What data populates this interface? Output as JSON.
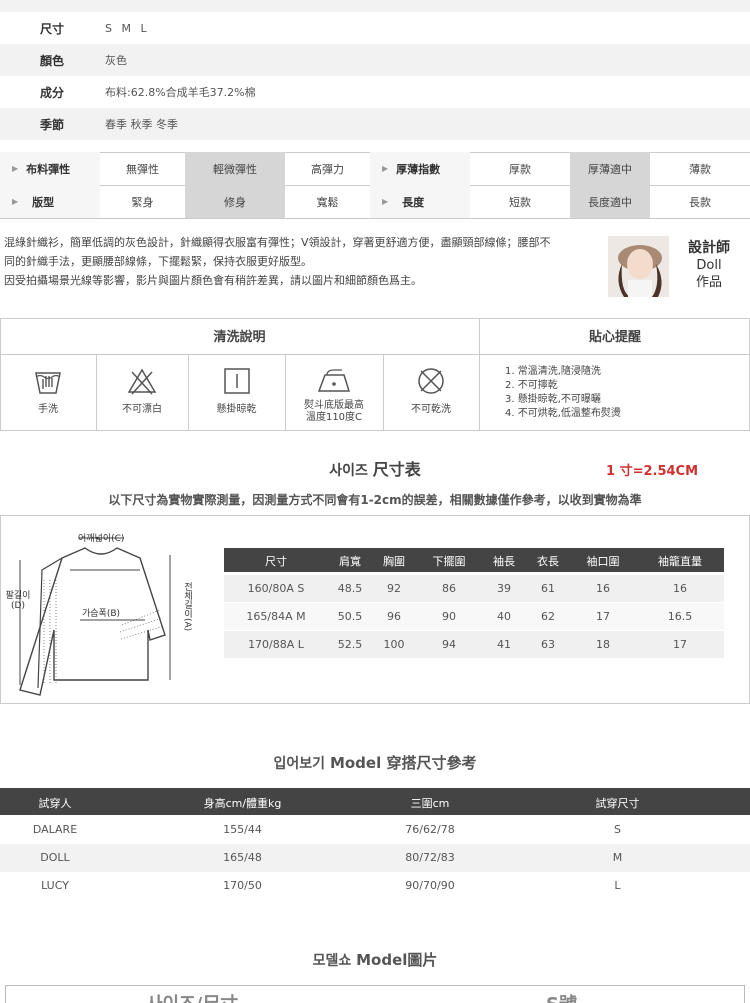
{
  "spec": [
    {
      "key": "尺寸",
      "value": "S M L"
    },
    {
      "key": "顏色",
      "value": "灰色"
    },
    {
      "key": "成分",
      "value": "布料:62.8%合成羊毛37.2%棉"
    },
    {
      "key": "季節",
      "value": "春季 秋季 冬季"
    }
  ],
  "attributes": {
    "row1": {
      "label1": "布料彈性",
      "opts1": [
        "無彈性",
        "輕微彈性",
        "高彈力"
      ],
      "label2": "厚薄指數",
      "opts2": [
        "厚款",
        "厚薄適中",
        "薄款"
      ]
    },
    "row2": {
      "label1": "版型",
      "opts1": [
        "緊身",
        "修身",
        "寬鬆"
      ],
      "label2": "長度",
      "opts2": [
        "短款",
        "長度適中",
        "長款"
      ]
    }
  },
  "description": {
    "line1": "混綠針織衫，簡單低調的灰色設計，針織顯得衣服富有彈性；V領設計，穿著更舒適方便，盡顯頸部線條；腰部不",
    "line2": "同的針織手法，更顯腰部線條，下擺鬆緊，保持衣服更好版型。",
    "line3": "因受拍攝場景光線等影響，影片與圖片顏色會有稍許差異，請以圖片和細節顏色爲主。"
  },
  "designer": {
    "title": "設計師",
    "name": "Doll",
    "suffix": "作品"
  },
  "care": {
    "title": "清洗說明",
    "tips_title": "貼心提醒",
    "items": [
      {
        "icon": "hand-wash-icon",
        "label": "手洗"
      },
      {
        "icon": "no-bleach-icon",
        "label": "不可漂白"
      },
      {
        "icon": "hang-dry-icon",
        "label": "懸掛晾乾"
      },
      {
        "icon": "iron-low-icon",
        "label": "熨斗底版最高",
        "label2": "溫度110度C"
      },
      {
        "icon": "no-dry-clean-icon",
        "label": "不可乾洗"
      }
    ],
    "tips": [
      "1. 常溫清洗,隨浸隨洗",
      "2. 不可擰乾",
      "3. 懸掛晾乾,不可曝曬",
      "4. 不可烘乾,低溫整布熨燙"
    ]
  },
  "size_section": {
    "title_kr": "사이즈",
    "title_zh": "尺寸表",
    "conversion": "1 寸=2.54CM",
    "note": "以下尺寸為實物實際測量，因測量方式不同會有1-2cm的誤差，相關數據僅作參考，以收到實物為準",
    "diagram_labels": {
      "shoulder": "어깨넓이(C)",
      "chest": "가슴폭(B)",
      "sleeve": "팔길이",
      "sleeve_code": "(D)",
      "length": "전체길이",
      "length_code": "(A)"
    },
    "headers": [
      "尺寸",
      "肩寬",
      "胸圍",
      "下擺圍",
      "袖長",
      "衣長",
      "袖口圍",
      "袖籠直量"
    ],
    "rows": [
      [
        "160/80A S",
        "48.5",
        "92",
        "86",
        "39",
        "61",
        "16",
        "16"
      ],
      [
        "165/84A M",
        "50.5",
        "96",
        "90",
        "40",
        "62",
        "17",
        "16.5"
      ],
      [
        "170/88A L",
        "52.5",
        "100",
        "94",
        "41",
        "63",
        "18",
        "17"
      ]
    ]
  },
  "model_section": {
    "title_kr": "입어보기",
    "title_zh": "Model 穿搭尺寸參考",
    "headers": [
      "試穿人",
      "身高cm/體重kg",
      "三圍cm",
      "試穿尺寸"
    ],
    "rows": [
      [
        "DALARE",
        "155/44",
        "76/62/78",
        "S"
      ],
      [
        "DOLL",
        "165/48",
        "80/72/83",
        "M"
      ],
      [
        "LUCY",
        "170/50",
        "90/70/90",
        "L"
      ]
    ]
  },
  "model_pics": {
    "title_kr": "모델쇼",
    "title_zh": "Model圖片",
    "cut1": "사이즈/尺寸",
    "cut2": "S號"
  }
}
